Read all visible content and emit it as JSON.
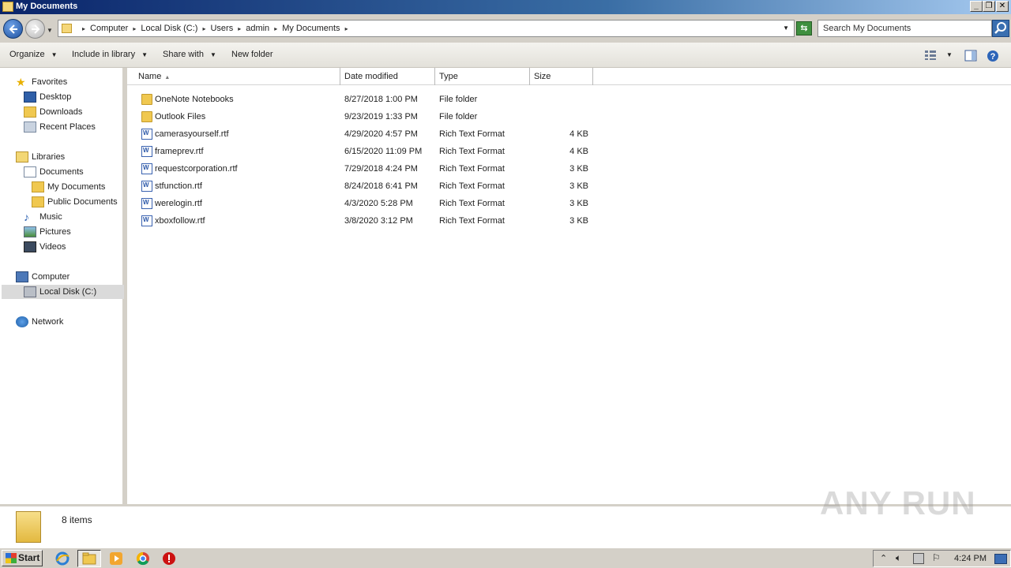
{
  "window": {
    "title": "My Documents"
  },
  "address": {
    "crumbs": [
      "Computer",
      "Local Disk (C:)",
      "Users",
      "admin",
      "My Documents"
    ],
    "search_placeholder": "Search My Documents"
  },
  "toolbar": {
    "organize": "Organize",
    "include_in_library": "Include in library",
    "share_with": "Share with",
    "new_folder": "New folder"
  },
  "nav": {
    "favorites": "Favorites",
    "desktop": "Desktop",
    "downloads": "Downloads",
    "recent_places": "Recent Places",
    "libraries": "Libraries",
    "documents": "Documents",
    "my_documents": "My Documents",
    "public_documents": "Public Documents",
    "music": "Music",
    "pictures": "Pictures",
    "videos": "Videos",
    "computer": "Computer",
    "local_disk": "Local Disk (C:)",
    "network": "Network"
  },
  "columns": {
    "name": "Name",
    "date": "Date modified",
    "type": "Type",
    "size": "Size"
  },
  "files": [
    {
      "name": "OneNote Notebooks",
      "date": "8/27/2018 1:00 PM",
      "type": "File folder",
      "size": "",
      "icon": "folder-icon"
    },
    {
      "name": "Outlook Files",
      "date": "9/23/2019 1:33 PM",
      "type": "File folder",
      "size": "",
      "icon": "folder-icon"
    },
    {
      "name": "camerasyourself.rtf",
      "date": "4/29/2020 4:57 PM",
      "type": "Rich Text Format",
      "size": "4 KB",
      "icon": "rtf-icon"
    },
    {
      "name": "frameprev.rtf",
      "date": "6/15/2020 11:09 PM",
      "type": "Rich Text Format",
      "size": "4 KB",
      "icon": "rtf-icon"
    },
    {
      "name": "requestcorporation.rtf",
      "date": "7/29/2018 4:24 PM",
      "type": "Rich Text Format",
      "size": "3 KB",
      "icon": "rtf-icon"
    },
    {
      "name": "stfunction.rtf",
      "date": "8/24/2018 6:41 PM",
      "type": "Rich Text Format",
      "size": "3 KB",
      "icon": "rtf-icon"
    },
    {
      "name": "werelogin.rtf",
      "date": "4/3/2020 5:28 PM",
      "type": "Rich Text Format",
      "size": "3 KB",
      "icon": "rtf-icon"
    },
    {
      "name": "xboxfollow.rtf",
      "date": "3/8/2020 3:12 PM",
      "type": "Rich Text Format",
      "size": "3 KB",
      "icon": "rtf-icon"
    }
  ],
  "details": {
    "item_count": "8 items"
  },
  "watermark": "ANY RUN",
  "taskbar": {
    "start": "Start",
    "clock": "4:24 PM"
  }
}
